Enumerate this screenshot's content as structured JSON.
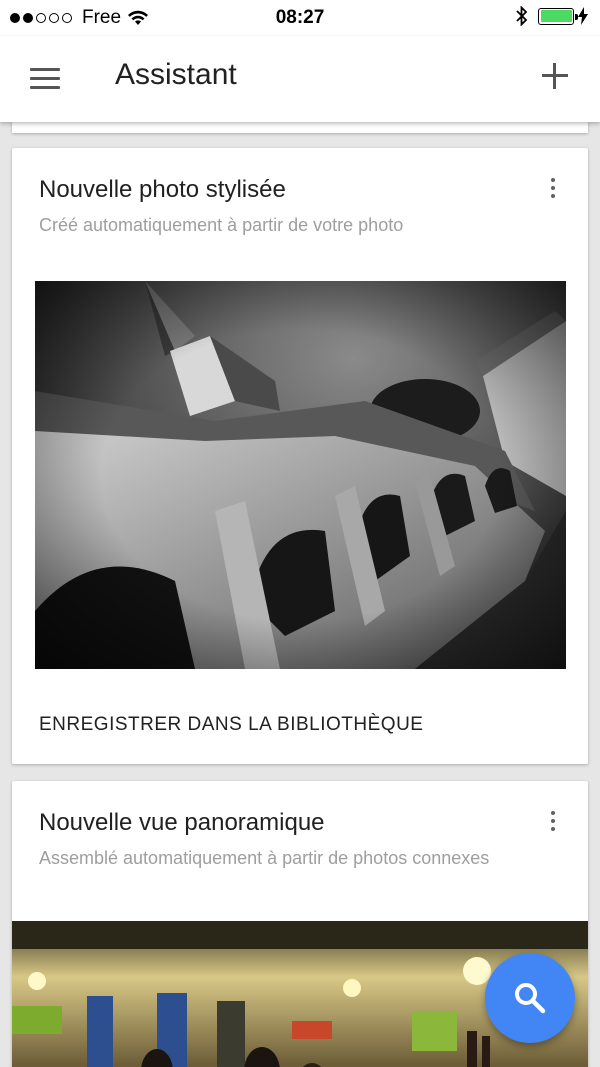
{
  "status_bar": {
    "carrier": "Free",
    "time": "08:27",
    "signal_dots_filled": 2,
    "signal_dots_total": 5,
    "battery_level": 1.0
  },
  "app_bar": {
    "title": "Assistant",
    "menu_icon": "menu-icon",
    "add_icon": "add-icon"
  },
  "cards": [
    {
      "title": "Nouvelle photo stylisée",
      "subtitle": "Créé automatiquement à partir de votre photo",
      "action": "ENREGISTRER DANS LA BIBLIOTHÈQUE",
      "image": "black and white photo of church cloister arches"
    },
    {
      "title": "Nouvelle vue panoramique",
      "subtitle": "Assemblé automatiquement à partir de photos connexes",
      "image": "panoramic photo of restaurant interior"
    }
  ],
  "fab": {
    "icon": "search-icon"
  },
  "colors": {
    "accent": "#4285f4",
    "background": "#e6e6e6",
    "battery": "#4cd964",
    "subtitle": "#9e9e9e"
  }
}
